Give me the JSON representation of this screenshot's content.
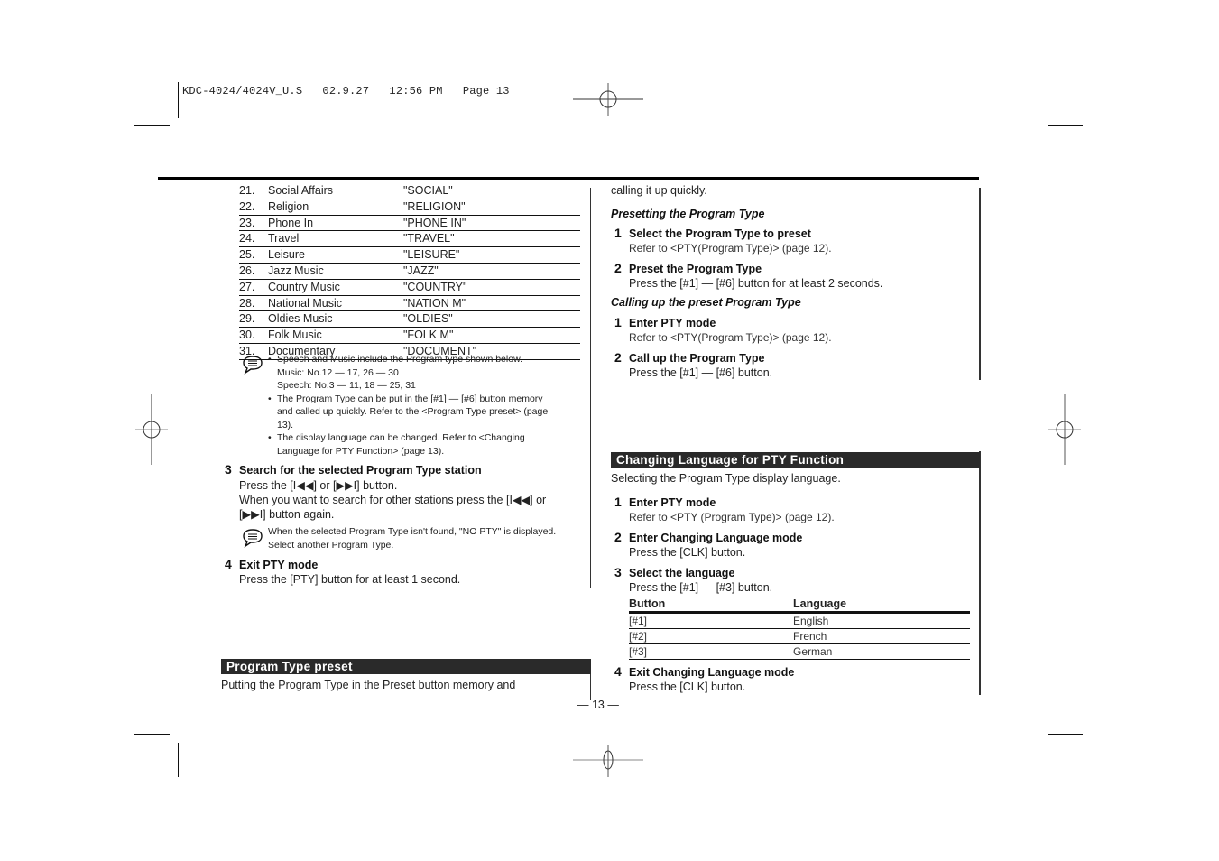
{
  "slug": "KDC-4024/4024V_U.S   02.9.27   12:56 PM   Page 13",
  "program_types": [
    {
      "num": "21.",
      "name": "Social Affairs",
      "code": "\"SOCIAL\""
    },
    {
      "num": "22.",
      "name": "Religion",
      "code": "\"RELIGION\""
    },
    {
      "num": "23.",
      "name": "Phone In",
      "code": "\"PHONE IN\""
    },
    {
      "num": "24.",
      "name": "Travel",
      "code": "\"TRAVEL\""
    },
    {
      "num": "25.",
      "name": "Leisure",
      "code": "\"LEISURE\""
    },
    {
      "num": "26.",
      "name": "Jazz Music",
      "code": "\"JAZZ\""
    },
    {
      "num": "27.",
      "name": "Country Music",
      "code": "\"COUNTRY\""
    },
    {
      "num": "28.",
      "name": "National Music",
      "code": "\"NATION M\""
    },
    {
      "num": "29.",
      "name": "Oldies Music",
      "code": "\"OLDIES\""
    },
    {
      "num": "30.",
      "name": "Folk Music",
      "code": "\"FOLK M\""
    },
    {
      "num": "31.",
      "name": "Documentary",
      "code": "\"DOCUMENT\""
    }
  ],
  "note1": {
    "bullet1_line1": "Speech and Music include the Program type shown below.",
    "bullet1_line2": "Music: No.12 — 17, 26 — 30",
    "bullet1_line3": "Speech: No.3 — 11, 18 — 25, 31",
    "bullet2_line1": "The Program Type can be put in the [#1] — [#6] button memory",
    "bullet2_line2": "and called up quickly. Refer to the <Program Type preset> (page",
    "bullet2_line3": "13).",
    "bullet3_line1": "The display language can be changed. Refer to <Changing",
    "bullet3_line2": "Language for PTY Function> (page 13)."
  },
  "step3": {
    "num": "3",
    "title": "Search for the selected Program Type station",
    "line1": "Press the [I◀◀] or [▶▶I] button.",
    "line2": "When you want to search for other stations press the [I◀◀] or",
    "line3": "[▶▶I] button again."
  },
  "note2": {
    "line1": "When the selected Program Type isn't found, \"NO PTY\" is displayed.",
    "line2": "Select another Program Type."
  },
  "step4": {
    "num": "4",
    "title": "Exit PTY mode",
    "line1": "Press the [PTY] button for at least 1 second."
  },
  "preset_section": {
    "title": "Program Type preset",
    "intro_line1": "Putting the Program Type in the Preset button memory and",
    "intro_line2": "calling it up quickly.",
    "presetting": {
      "heading": "Presetting the Program Type",
      "steps": [
        {
          "num": "1",
          "title": "Select the Program Type to preset",
          "text": "Refer to <PTY(Program Type)> (page 12)."
        },
        {
          "num": "2",
          "title": "Preset the Program Type",
          "text": "Press the [#1] — [#6] button for at least 2 seconds."
        }
      ]
    },
    "calling": {
      "heading": "Calling up the preset Program Type",
      "steps": [
        {
          "num": "1",
          "title": "Enter PTY mode",
          "text": "Refer to <PTY(Program Type)> (page 12)."
        },
        {
          "num": "2",
          "title": "Call up the Program Type",
          "text": "Press the [#1] — [#6] button."
        }
      ]
    }
  },
  "language_section": {
    "title": "Changing Language for PTY Function",
    "intro": "Selecting the Program Type display language.",
    "steps": [
      {
        "num": "1",
        "title": "Enter PTY mode",
        "text": "Refer to <PTY (Program Type)> (page 12)."
      },
      {
        "num": "2",
        "title": "Enter Changing Language mode",
        "text": "Press the [CLK] button."
      },
      {
        "num": "3",
        "title": "Select the language",
        "text": "Press the [#1] — [#3] button."
      },
      {
        "num": "4",
        "title": "Exit Changing Language mode",
        "text": "Press the [CLK] button."
      }
    ],
    "table": {
      "headers": [
        "Button",
        "Language"
      ],
      "rows": [
        [
          "[#1]",
          "English"
        ],
        [
          "[#2]",
          "French"
        ],
        [
          "[#3]",
          "German"
        ]
      ]
    }
  },
  "page_number": "— 13 —"
}
